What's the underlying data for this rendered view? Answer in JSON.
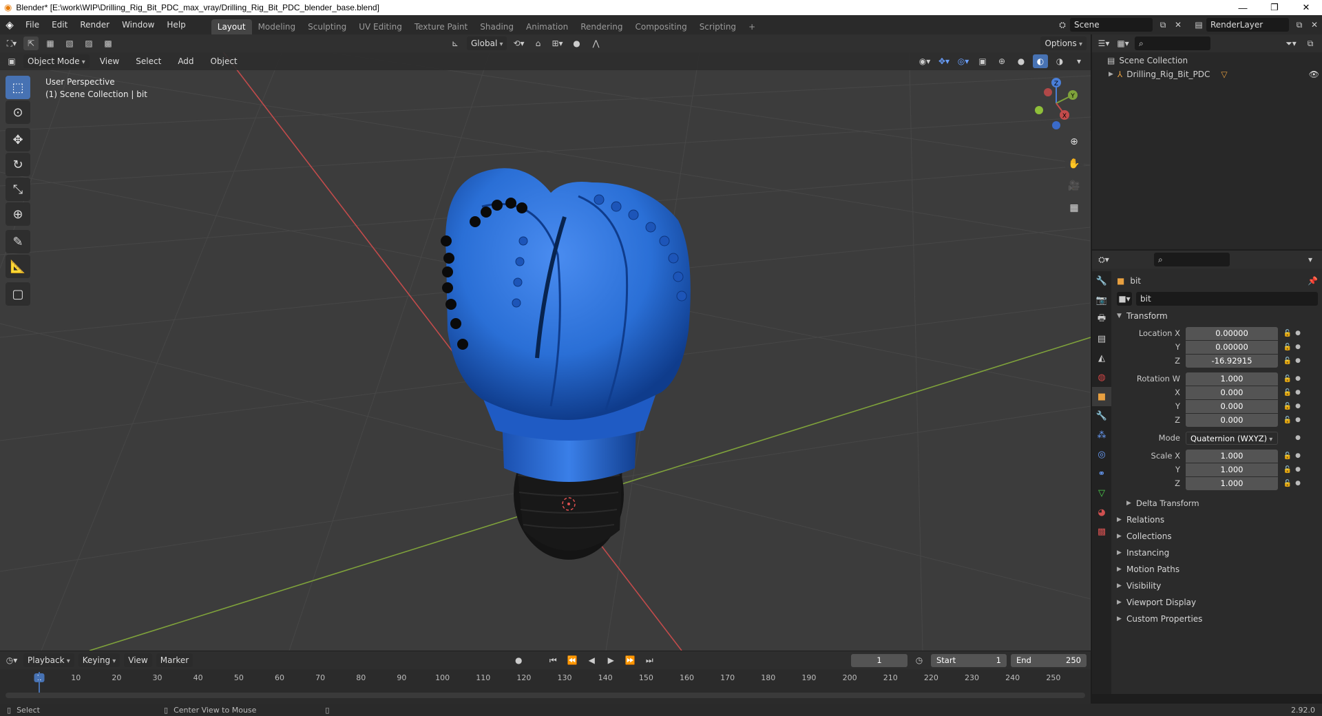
{
  "window": {
    "title": "Blender* [E:\\work\\WIP\\Drilling_Rig_Bit_PDC_max_vray/Drilling_Rig_Bit_PDC_blender_base.blend]",
    "controls": [
      "—",
      "❐",
      "✕"
    ]
  },
  "menubar": {
    "items": [
      "File",
      "Edit",
      "Render",
      "Window",
      "Help"
    ],
    "workspaces": [
      "Layout",
      "Modeling",
      "Sculpting",
      "UV Editing",
      "Texture Paint",
      "Shading",
      "Animation",
      "Rendering",
      "Compositing",
      "Scripting"
    ],
    "active_workspace": "Layout",
    "add_workspace": "+",
    "scene": "Scene",
    "render_layer": "RenderLayer"
  },
  "viewport_header": {
    "orientation": "Global",
    "options": "Options",
    "mode": "Object Mode",
    "menus": [
      "View",
      "Select",
      "Add",
      "Object"
    ]
  },
  "viewport": {
    "perspective": "User Perspective",
    "collection_info": "(1) Scene Collection | bit",
    "axes": [
      "X",
      "Y",
      "Z"
    ]
  },
  "outliner": {
    "root": "Scene Collection",
    "items": [
      {
        "label": "Drilling_Rig_Bit_PDC"
      }
    ]
  },
  "properties": {
    "object_name": "bit",
    "data_name": "bit",
    "transform_title": "Transform",
    "location": {
      "label": "Location X",
      "x": "0.00000",
      "y": "0.00000",
      "z": "-16.92915"
    },
    "rotation": {
      "label": "Rotation W",
      "w": "1.000",
      "x": "0.000",
      "y": "0.000",
      "z": "0.000"
    },
    "mode": {
      "label": "Mode",
      "value": "Quaternion (WXYZ)"
    },
    "scale": {
      "label": "Scale X",
      "x": "1.000",
      "y": "1.000",
      "z": "1.000"
    },
    "axis_y": "Y",
    "axis_z": "Z",
    "axis_x": "X",
    "delta_transform": "Delta Transform",
    "panels": [
      "Relations",
      "Collections",
      "Instancing",
      "Motion Paths",
      "Visibility",
      "Viewport Display",
      "Custom Properties"
    ]
  },
  "timeline": {
    "menus": [
      "Playback",
      "Keying",
      "View",
      "Marker"
    ],
    "current_frame": "1",
    "start_label": "Start",
    "start": "1",
    "end_label": "End",
    "end": "250",
    "ticks": [
      "1",
      "10",
      "20",
      "30",
      "40",
      "50",
      "60",
      "70",
      "80",
      "90",
      "100",
      "110",
      "120",
      "130",
      "140",
      "150",
      "160",
      "170",
      "180",
      "190",
      "200",
      "210",
      "220",
      "230",
      "240",
      "250"
    ]
  },
  "statusbar": {
    "select": "Select",
    "center_view": "Center View to Mouse",
    "version": "2.92.0"
  },
  "colors": {
    "accent": "#4772b3",
    "bit_blue": "#2a6fd6",
    "x_axis": "#c24b4b",
    "y_axis": "#7fa23b"
  }
}
